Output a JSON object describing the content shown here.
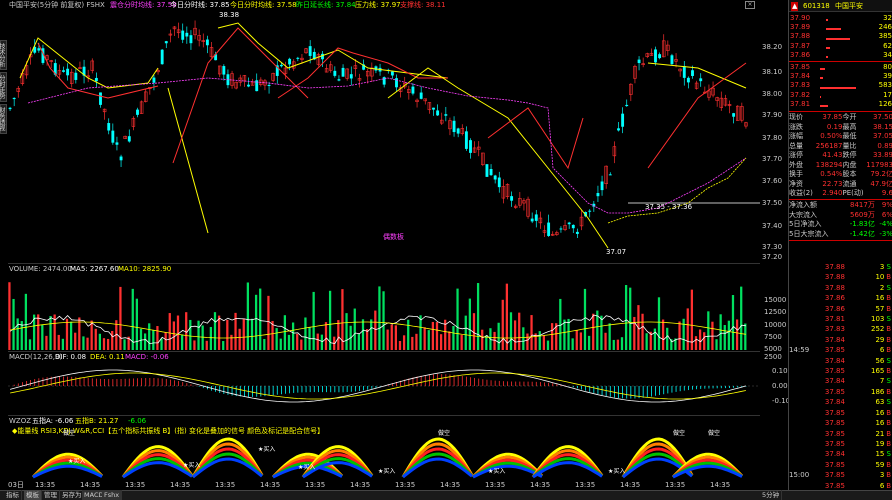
{
  "chart_header": {
    "title": "中国平安(5分钟 前复权) FSHX",
    "indicator1": "震仓分时均线: 37.58",
    "indicator2": "今日分时线: 37.85",
    "indicator3": "今日分时均线: 37.58",
    "indicator4": "昨日延长线: 37.84",
    "indicator5": "压力线: 37.97",
    "indicator6": "支撑线: 38.11"
  },
  "price_axis": [
    "38.20",
    "38.10",
    "38.00",
    "37.90",
    "37.80",
    "37.70",
    "37.60",
    "37.50",
    "37.40",
    "37.30",
    "37.20"
  ],
  "price_annotations": {
    "high": "38.38",
    "low": "37.07",
    "range": "37.35 - 37.36",
    "mid_label": "偶数板"
  },
  "volume_header": {
    "label": "VOLUME: 2474.00",
    "ma5": "MA5: 2267.60",
    "ma10": "MA10: 2825.90"
  },
  "volume_axis": [
    "15000",
    "12500",
    "10000",
    "7500",
    "5000",
    "2500"
  ],
  "macd_header": {
    "label": "MACD(12,26,9)",
    "dif": "DIF: 0.08",
    "dea": "DEA: 0.11",
    "macd": "MACD: -0.06"
  },
  "macd_axis": [
    "0.10",
    "0.00",
    "-0.10"
  ],
  "wz_header": {
    "label": "WZOZ",
    "a": "五指A: -6.06",
    "b": "五指B: 21.27",
    "c": "-6.06",
    "note": "◆能量线 RSI3,KDJ,W&R,CCI【五个指标共振线 B】(指) 变化是叠加的信号 颜色及标记是配合信号】"
  },
  "chart_labels": {
    "buy": "买入",
    "short": "做空"
  },
  "time_axis": [
    "03日",
    "13:35",
    "14:35",
    "13:35",
    "14:35",
    "13:35",
    "14:35",
    "13:35",
    "14:35",
    "13:35",
    "14:35",
    "13:35",
    "14:35",
    "13:35",
    "14:35",
    "13:35",
    "14:35"
  ],
  "bottom_tabs": [
    "指标",
    "模板",
    "管理",
    "另存为",
    "MACD",
    "Fshx"
  ],
  "period_label": "5分钟",
  "side_tabs": [
    "技术分析",
    "分时走势",
    "财务透视"
  ],
  "stock": {
    "code": "601318",
    "name": "中国平安"
  },
  "order_book": {
    "asks": [
      {
        "price": "37.90",
        "qty": "32"
      },
      {
        "price": "37.89",
        "qty": "246"
      },
      {
        "price": "37.88",
        "qty": "385"
      },
      {
        "price": "37.87",
        "qty": "62"
      },
      {
        "price": "37.86",
        "qty": "34"
      }
    ],
    "bids": [
      {
        "price": "37.85",
        "qty": "80"
      },
      {
        "price": "37.84",
        "qty": "39"
      },
      {
        "price": "37.83",
        "qty": "583"
      },
      {
        "price": "37.82",
        "qty": "17"
      },
      {
        "price": "37.81",
        "qty": "126"
      }
    ]
  },
  "quote": [
    {
      "l1": "现价",
      "v1": "37.85",
      "l2": "今开",
      "v2": "37.50"
    },
    {
      "l1": "涨跌",
      "v1": "0.19",
      "l2": "最高",
      "v2": "38.15"
    },
    {
      "l1": "涨幅",
      "v1": "0.50%",
      "l2": "最低",
      "v2": "37.05"
    },
    {
      "l1": "总量",
      "v1": "256187",
      "l2": "量比",
      "v2": "0.89"
    },
    {
      "l1": "涨停",
      "v1": "41.43",
      "l2": "跌停",
      "v2": "33.89"
    },
    {
      "l1": "外盘",
      "v1": "138294",
      "l2": "内盘",
      "v2": "117983"
    },
    {
      "l1": "换手",
      "v1": "0.54%",
      "l2": "股本",
      "v2": "79.2亿"
    },
    {
      "l1": "净资",
      "v1": "22.73",
      "l2": "流通",
      "v2": "47.9亿"
    },
    {
      "l1": "收益(2)",
      "v1": "2.940",
      "l2": "PE(动)",
      "v2": "9.6"
    }
  ],
  "flows": [
    {
      "label": "净流入额",
      "value": "8417万",
      "pct": "9%"
    },
    {
      "label": "大宗流入",
      "value": "5609万",
      "pct": "6%"
    },
    {
      "label": "5日净流入",
      "value": "-1.83亿",
      "pct": "-4%"
    },
    {
      "label": "5日大宗流入",
      "value": "-1.42亿",
      "pct": "-3%"
    }
  ],
  "ticks": [
    {
      "time": "",
      "price": "37.88",
      "vol": "3",
      "side": "S"
    },
    {
      "time": "",
      "price": "37.88",
      "vol": "10",
      "side": "B"
    },
    {
      "time": "",
      "price": "37.88",
      "vol": "2",
      "side": "S"
    },
    {
      "time": "",
      "price": "37.86",
      "vol": "16",
      "side": "B"
    },
    {
      "time": "",
      "price": "37.86",
      "vol": "57",
      "side": "B"
    },
    {
      "time": "",
      "price": "37.81",
      "vol": "103",
      "side": "S"
    },
    {
      "time": "",
      "price": "37.83",
      "vol": "252",
      "side": "B"
    },
    {
      "time": "",
      "price": "37.84",
      "vol": "29",
      "side": "B"
    },
    {
      "time": "14:59",
      "price": "37.85",
      "vol": "6",
      "side": "B"
    },
    {
      "time": "",
      "price": "37.84",
      "vol": "56",
      "side": "S"
    },
    {
      "time": "",
      "price": "37.85",
      "vol": "165",
      "side": "B"
    },
    {
      "time": "",
      "price": "37.84",
      "vol": "7",
      "side": "S"
    },
    {
      "time": "",
      "price": "37.85",
      "vol": "186",
      "side": "B"
    },
    {
      "time": "",
      "price": "37.84",
      "vol": "63",
      "side": "S"
    },
    {
      "time": "",
      "price": "37.85",
      "vol": "16",
      "side": "B"
    },
    {
      "time": "",
      "price": "37.85",
      "vol": "16",
      "side": "B"
    },
    {
      "time": "",
      "price": "37.85",
      "vol": "21",
      "side": "B"
    },
    {
      "time": "",
      "price": "37.85",
      "vol": "19",
      "side": "B"
    },
    {
      "time": "",
      "price": "37.84",
      "vol": "15",
      "side": "S"
    },
    {
      "time": "",
      "price": "37.85",
      "vol": "59",
      "side": "B"
    },
    {
      "time": "15:00",
      "price": "37.85",
      "vol": "3",
      "side": "B"
    },
    {
      "time": "",
      "price": "37.85",
      "vol": "6",
      "side": "B"
    }
  ],
  "colors": {
    "up": "#ff3030",
    "down": "#00ffff",
    "volume_up": "#ff3030",
    "volume_down": "#00e060",
    "yellow": "#ffff00",
    "magenta": "#ff40ff",
    "ma": "#ffffff"
  }
}
